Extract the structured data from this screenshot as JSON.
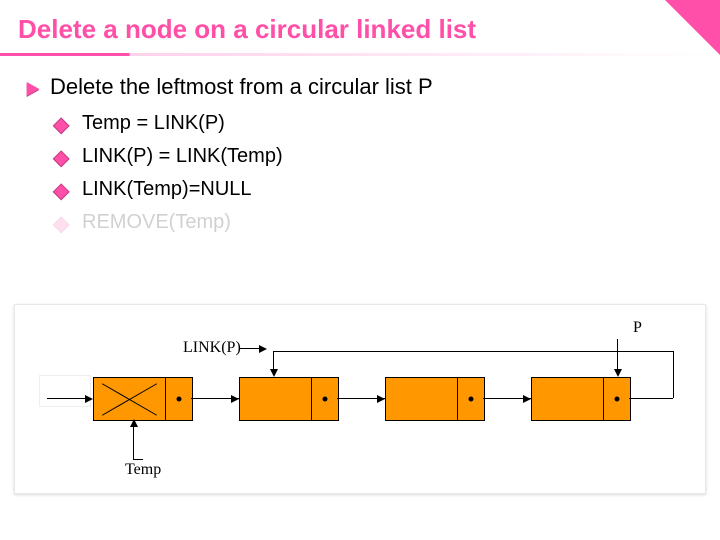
{
  "title": "Delete a node on a circular linked list",
  "bullets": {
    "l1": "Delete the leftmost from a circular list P",
    "l2a": "Temp = LINK(P)",
    "l2b": "LINK(P) = LINK(Temp)",
    "l2c": "LINK(Temp)=NULL",
    "l2d": "REMOVE(Temp)"
  },
  "diagram": {
    "label_linkP": "LINK(P)",
    "label_P": "P",
    "label_Temp": "Temp"
  }
}
